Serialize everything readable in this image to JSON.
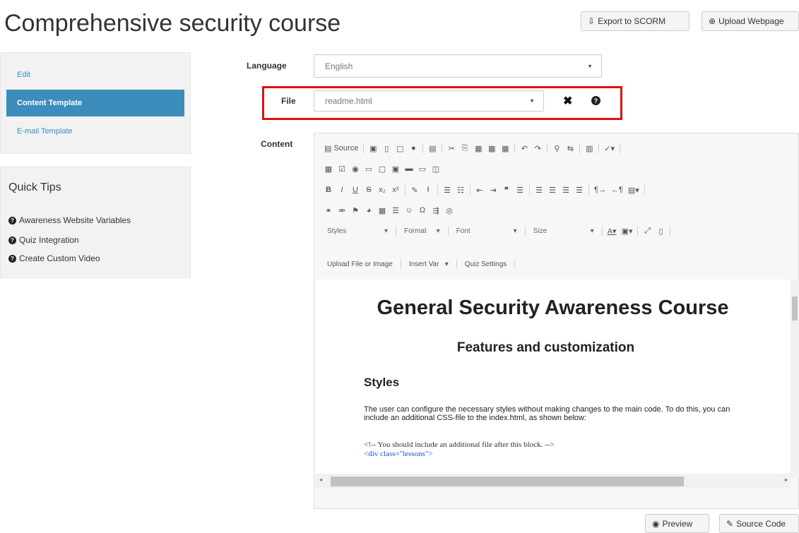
{
  "page": {
    "title": "Comprehensive security course"
  },
  "header": {
    "export_label": "Export to SCORM",
    "upload_label": "Upload Webpage"
  },
  "sidebar": {
    "items": [
      {
        "label": "Edit",
        "active": false
      },
      {
        "label": "Content Template",
        "active": true
      },
      {
        "label": "E-mail Template",
        "active": false
      }
    ]
  },
  "quick_tips": {
    "title": "Quick Tips",
    "items": [
      "Awareness Website Variables",
      "Quiz Integration",
      "Create Custom Video"
    ]
  },
  "form": {
    "language_label": "Language",
    "language_value": "English",
    "file_label": "File",
    "file_value": "readme.html",
    "content_label": "Content"
  },
  "editor": {
    "source_label": "Source",
    "styles_label": "Styles",
    "format_label": "Format",
    "font_label": "Font",
    "size_label": "Size",
    "upload_label": "Upload File or Image",
    "insert_var_label": "Insert Var",
    "quiz_settings_label": "Quiz Settings"
  },
  "document": {
    "h1": "General Security Awareness Course",
    "h2": "Features and customization",
    "h3": "Styles",
    "paragraph": "The user can configure the necessary styles without making changes to the main code. To do this, you can include an additional CSS-file to the index.html, as shown below:",
    "code_comment": "<!-- You should include an additional file after this block. -->",
    "code_line": "<div class=\"lessons\">"
  },
  "footer": {
    "preview_label": "Preview",
    "source_code_label": "Source Code"
  },
  "colors": {
    "accent": "#3c8dbc",
    "highlight_border": "#e01010"
  }
}
